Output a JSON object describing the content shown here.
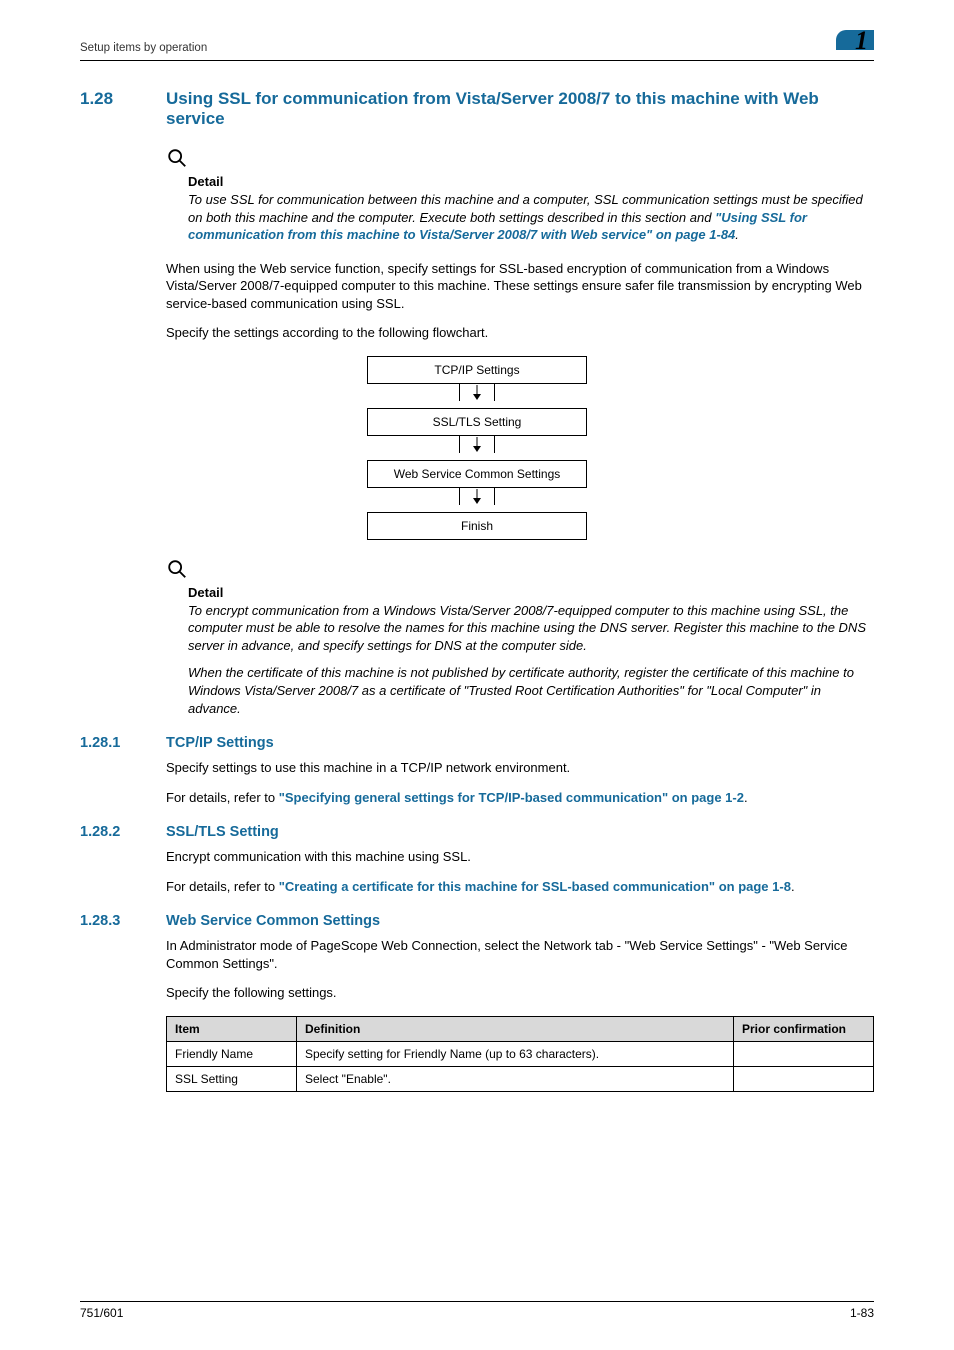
{
  "header": {
    "running": "Setup items by operation",
    "chapter_number": "1"
  },
  "section": {
    "number": "1.28",
    "title": "Using SSL for communication from Vista/Server 2008/7 to this machine with Web service"
  },
  "detail1": {
    "heading": "Detail",
    "text_before": "To use SSL for communication between this machine and a computer, SSL communication settings must be specified on both this machine and the computer. Execute both settings described in this section and ",
    "link": "\"Using SSL for communication from this machine to Vista/Server 2008/7 with Web service\" on page 1-84",
    "text_after": "."
  },
  "intro": {
    "p1": "When using the Web service function, specify settings for SSL-based encryption of communication from a Windows Vista/Server 2008/7-equipped computer to this machine. These settings ensure safer file transmission by encrypting Web service-based communication using SSL.",
    "p2": "Specify the settings according to the following flowchart."
  },
  "flow": {
    "b1": "TCP/IP Settings",
    "b2": "SSL/TLS Setting",
    "b3": "Web Service Common Settings",
    "b4": "Finish"
  },
  "detail2": {
    "heading": "Detail",
    "p1": "To encrypt communication from a Windows Vista/Server 2008/7-equipped computer to this machine using SSL, the computer must be able to resolve the names for this machine using the DNS server. Register this machine to the DNS server in advance, and specify settings for DNS at the computer side.",
    "p2": "When the certificate of this machine is not published by certificate authority, register the certificate of this machine to Windows Vista/Server 2008/7 as a certificate of \"Trusted Root Certification Authorities\" for \"Local Computer\" in advance."
  },
  "sub1": {
    "number": "1.28.1",
    "title": "TCP/IP Settings",
    "p1": "Specify settings to use this machine in a TCP/IP network environment.",
    "p2_before": "For details, refer to ",
    "p2_link": "\"Specifying general settings for TCP/IP-based communication\" on page 1-2",
    "p2_after": "."
  },
  "sub2": {
    "number": "1.28.2",
    "title": "SSL/TLS Setting",
    "p1": "Encrypt communication with this machine using SSL.",
    "p2_before": "For details, refer to ",
    "p2_link": "\"Creating a certificate for this machine for SSL-based communication\" on page 1-8",
    "p2_after": "."
  },
  "sub3": {
    "number": "1.28.3",
    "title": "Web Service Common Settings",
    "p1": "In Administrator mode of PageScope Web Connection, select the Network tab - \"Web Service Settings\" - \"Web Service Common Settings\".",
    "p2": "Specify the following settings."
  },
  "table": {
    "headers": {
      "item": "Item",
      "definition": "Definition",
      "prior": "Prior confirmation"
    },
    "rows": [
      {
        "item": "Friendly Name",
        "definition": "Specify setting for Friendly Name (up to 63 characters).",
        "prior": ""
      },
      {
        "item": "SSL Setting",
        "definition": "Select \"Enable\".",
        "prior": ""
      }
    ]
  },
  "footer": {
    "left": "751/601",
    "right": "1-83"
  }
}
